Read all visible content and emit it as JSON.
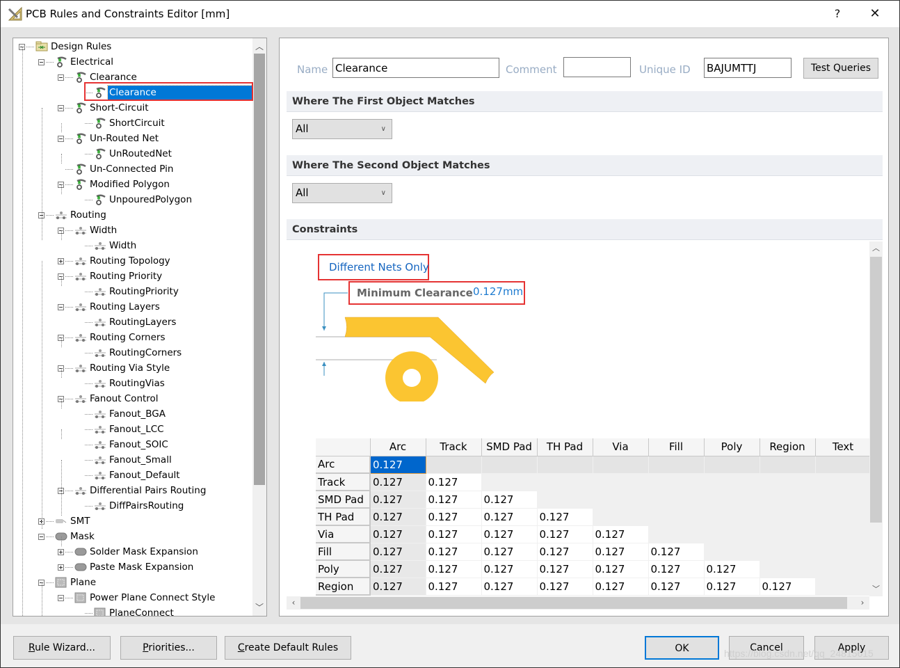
{
  "window": {
    "title": "PCB Rules and Constraints Editor [mm]",
    "help_label": "?",
    "close_label": "✕"
  },
  "tree": {
    "items": [
      {
        "label": "Design Rules",
        "level": 0,
        "icon": "design-rules-folder-icon",
        "expander": "minus"
      },
      {
        "label": "Electrical",
        "level": 1,
        "icon": "electrical-rule-icon",
        "expander": "minus"
      },
      {
        "label": "Clearance",
        "level": 2,
        "icon": "electrical-rule-icon",
        "expander": "minus"
      },
      {
        "label": "Clearance",
        "level": 3,
        "icon": "electrical-rule-icon",
        "expander": "none",
        "selected": true
      },
      {
        "label": "Short-Circuit",
        "level": 2,
        "icon": "electrical-rule-icon",
        "expander": "minus"
      },
      {
        "label": "ShortCircuit",
        "level": 3,
        "icon": "electrical-rule-icon",
        "expander": "none"
      },
      {
        "label": "Un-Routed Net",
        "level": 2,
        "icon": "electrical-rule-icon",
        "expander": "minus"
      },
      {
        "label": "UnRoutedNet",
        "level": 3,
        "icon": "electrical-rule-icon",
        "expander": "none"
      },
      {
        "label": "Un-Connected Pin",
        "level": 2,
        "icon": "electrical-rule-icon",
        "expander": "none"
      },
      {
        "label": "Modified Polygon",
        "level": 2,
        "icon": "electrical-rule-icon",
        "expander": "minus"
      },
      {
        "label": "UnpouredPolygon",
        "level": 3,
        "icon": "electrical-rule-icon",
        "expander": "none"
      },
      {
        "label": "Routing",
        "level": 1,
        "icon": "routing-rule-icon",
        "expander": "minus"
      },
      {
        "label": "Width",
        "level": 2,
        "icon": "routing-rule-icon",
        "expander": "minus"
      },
      {
        "label": "Width",
        "level": 3,
        "icon": "routing-rule-icon",
        "expander": "none"
      },
      {
        "label": "Routing Topology",
        "level": 2,
        "icon": "routing-rule-icon",
        "expander": "plus"
      },
      {
        "label": "Routing Priority",
        "level": 2,
        "icon": "routing-rule-icon",
        "expander": "minus"
      },
      {
        "label": "RoutingPriority",
        "level": 3,
        "icon": "routing-rule-icon",
        "expander": "none"
      },
      {
        "label": "Routing Layers",
        "level": 2,
        "icon": "routing-rule-icon",
        "expander": "minus"
      },
      {
        "label": "RoutingLayers",
        "level": 3,
        "icon": "routing-rule-icon",
        "expander": "none"
      },
      {
        "label": "Routing Corners",
        "level": 2,
        "icon": "routing-rule-icon",
        "expander": "minus"
      },
      {
        "label": "RoutingCorners",
        "level": 3,
        "icon": "routing-rule-icon",
        "expander": "none"
      },
      {
        "label": "Routing Via Style",
        "level": 2,
        "icon": "routing-rule-icon",
        "expander": "minus"
      },
      {
        "label": "RoutingVias",
        "level": 3,
        "icon": "routing-rule-icon",
        "expander": "none"
      },
      {
        "label": "Fanout Control",
        "level": 2,
        "icon": "routing-rule-icon",
        "expander": "minus"
      },
      {
        "label": "Fanout_BGA",
        "level": 3,
        "icon": "routing-rule-icon",
        "expander": "none"
      },
      {
        "label": "Fanout_LCC",
        "level": 3,
        "icon": "routing-rule-icon",
        "expander": "none"
      },
      {
        "label": "Fanout_SOIC",
        "level": 3,
        "icon": "routing-rule-icon",
        "expander": "none"
      },
      {
        "label": "Fanout_Small",
        "level": 3,
        "icon": "routing-rule-icon",
        "expander": "none"
      },
      {
        "label": "Fanout_Default",
        "level": 3,
        "icon": "routing-rule-icon",
        "expander": "none"
      },
      {
        "label": "Differential Pairs Routing",
        "level": 2,
        "icon": "routing-rule-icon",
        "expander": "minus"
      },
      {
        "label": "DiffPairsRouting",
        "level": 3,
        "icon": "routing-rule-icon",
        "expander": "none"
      },
      {
        "label": "SMT",
        "level": 1,
        "icon": "smt-rule-icon",
        "expander": "plus"
      },
      {
        "label": "Mask",
        "level": 1,
        "icon": "mask-rule-icon",
        "expander": "minus"
      },
      {
        "label": "Solder Mask Expansion",
        "level": 2,
        "icon": "mask-rule-icon",
        "expander": "plus"
      },
      {
        "label": "Paste Mask Expansion",
        "level": 2,
        "icon": "mask-rule-icon",
        "expander": "plus"
      },
      {
        "label": "Plane",
        "level": 1,
        "icon": "plane-rule-icon",
        "expander": "minus"
      },
      {
        "label": "Power Plane Connect Style",
        "level": 2,
        "icon": "plane-rule-icon",
        "expander": "minus"
      },
      {
        "label": "PlaneConnect",
        "level": 3,
        "icon": "plane-rule-icon",
        "expander": "none"
      }
    ]
  },
  "rule": {
    "name_label": "Name",
    "name_value": "Clearance",
    "comment_label": "Comment",
    "comment_value": "",
    "uid_label": "Unique ID",
    "uid_value": "BAJUMTTJ",
    "test_queries_label": "Test Queries"
  },
  "first_match": {
    "header": "Where The First Object Matches",
    "selected": "All"
  },
  "second_match": {
    "header": "Where The Second Object Matches",
    "selected": "All"
  },
  "constraints": {
    "header": "Constraints",
    "net_scope": "Different Nets Only",
    "min_clearance_label": "Minimum Clearance",
    "min_clearance_value": "0.127mm",
    "matrix": {
      "columns": [
        "Arc",
        "Track",
        "SMD Pad",
        "TH Pad",
        "Via",
        "Fill",
        "Poly",
        "Region",
        "Text"
      ],
      "rows": [
        {
          "label": "Arc",
          "values": [
            "0.127"
          ]
        },
        {
          "label": "Track",
          "values": [
            "0.127",
            "0.127"
          ]
        },
        {
          "label": "SMD Pad",
          "values": [
            "0.127",
            "0.127",
            "0.127"
          ]
        },
        {
          "label": "TH Pad",
          "values": [
            "0.127",
            "0.127",
            "0.127",
            "0.127"
          ]
        },
        {
          "label": "Via",
          "values": [
            "0.127",
            "0.127",
            "0.127",
            "0.127",
            "0.127"
          ]
        },
        {
          "label": "Fill",
          "values": [
            "0.127",
            "0.127",
            "0.127",
            "0.127",
            "0.127",
            "0.127"
          ]
        },
        {
          "label": "Poly",
          "values": [
            "0.127",
            "0.127",
            "0.127",
            "0.127",
            "0.127",
            "0.127",
            "0.127"
          ]
        },
        {
          "label": "Region",
          "values": [
            "0.127",
            "0.127",
            "0.127",
            "0.127",
            "0.127",
            "0.127",
            "0.127",
            "0.127"
          ]
        }
      ]
    }
  },
  "buttons": {
    "rule_wizard": {
      "u": "R",
      "rest": "ule Wizard..."
    },
    "priorities": {
      "u": "P",
      "rest": "riorities..."
    },
    "create_default": {
      "u": "C",
      "rest": "reate Default Rules"
    },
    "ok": "OK",
    "cancel": "Cancel",
    "apply": "Apply"
  },
  "watermark": "https://blog.csdn.net/qq_24815615",
  "colors": {
    "selection": "#0078d7",
    "highlight_box": "#e53333",
    "link_blue": "#1565c0",
    "copper": "#fbc531"
  }
}
